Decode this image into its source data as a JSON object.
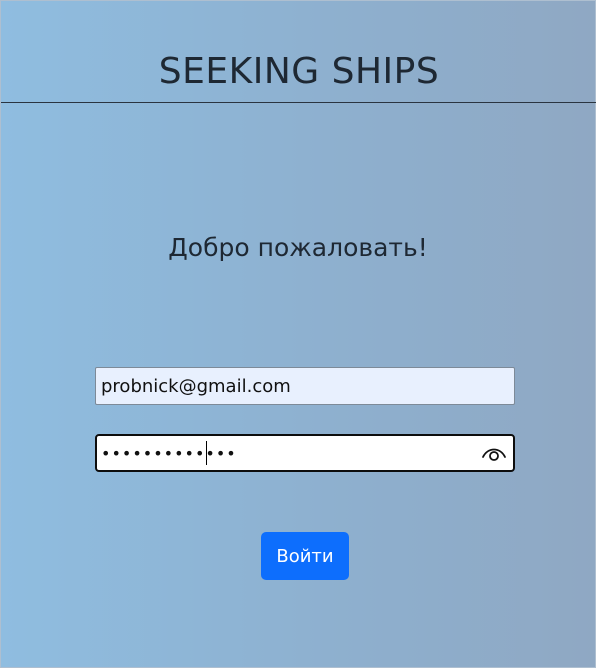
{
  "header": {
    "title": "SEEKING SHIPS"
  },
  "main": {
    "welcome": "Добро пожаловать!",
    "email": {
      "value": "probnick@gmail.com"
    },
    "password": {
      "masked_value": "•••••••••••••",
      "toggle_icon": "eye-icon"
    },
    "login_label": "Войти"
  },
  "colors": {
    "accent": "#0d6efd",
    "autofill_bg": "#e8f0fe"
  }
}
